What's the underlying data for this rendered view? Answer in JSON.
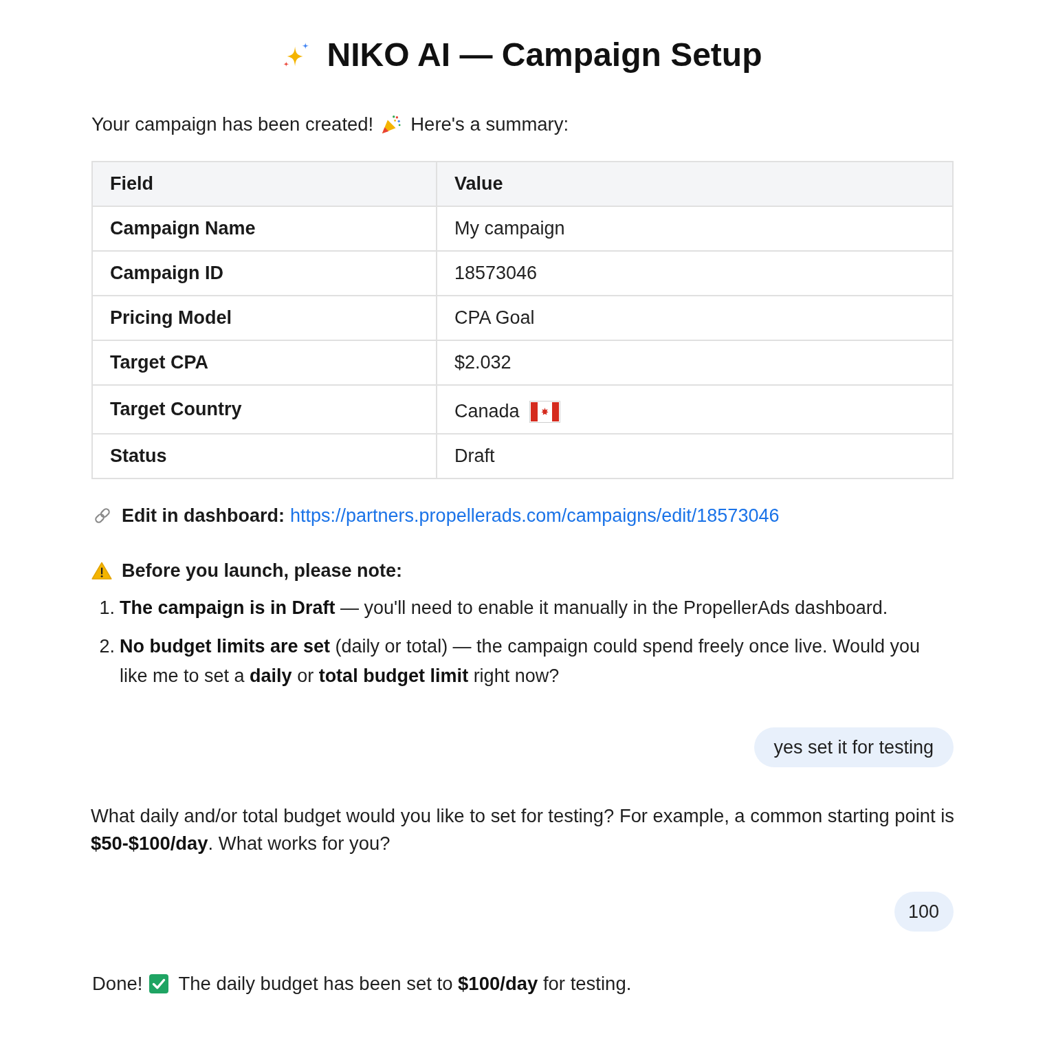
{
  "title": "NIKO AI — Campaign Setup",
  "messages": [
    {
      "kind": "assistant",
      "blocks": [
        {
          "kind": "celebration",
          "before": "Your campaign has been created!",
          "after": "Here's a summary:"
        },
        {
          "kind": "table",
          "columns": [
            "Field",
            "Value"
          ],
          "rows": [
            {
              "field": "Campaign Name",
              "value": "My campaign",
              "kind": "text"
            },
            {
              "field": "Campaign ID",
              "value": "18573046",
              "kind": "text"
            },
            {
              "field": "Pricing Model",
              "value": "CPA Goal",
              "kind": "text"
            },
            {
              "field": "Target CPA",
              "value": "$2.032",
              "kind": "text"
            },
            {
              "field": "Target Country",
              "value": "Canada",
              "kind": "country"
            },
            {
              "field": "Status",
              "value": "Draft",
              "kind": "text"
            }
          ]
        },
        {
          "kind": "link",
          "label": "Edit in dashboard:",
          "url": "https://partners.propellerads.com/campaigns/edit/18573046"
        },
        {
          "kind": "notice",
          "heading": "Before you launch, please note:",
          "items": [
            {
              "number": "1.",
              "text": "**The campaign is in Draft** — you'll need to enable it manually in the PropellerAds dashboard."
            },
            {
              "number": "2.",
              "text": "**No budget limits are set** (daily or total) — the campaign could spend freely once live. Would you like me to set a **daily** or **total budget limit** right now?"
            }
          ]
        }
      ]
    },
    {
      "kind": "user",
      "text": "yes set it for testing"
    },
    {
      "kind": "assistant",
      "blocks": [
        {
          "kind": "paragraph",
          "text": "What daily and/or total budget would you like to set for testing? For example, a common starting point is **$50-$100/day**. What works for you?"
        }
      ]
    },
    {
      "kind": "user",
      "text": "100"
    },
    {
      "kind": "assistant",
      "blocks": [
        {
          "kind": "success",
          "before": "Done!",
          "after": "The daily budget has been set to **$100/day** for testing."
        }
      ]
    }
  ]
}
